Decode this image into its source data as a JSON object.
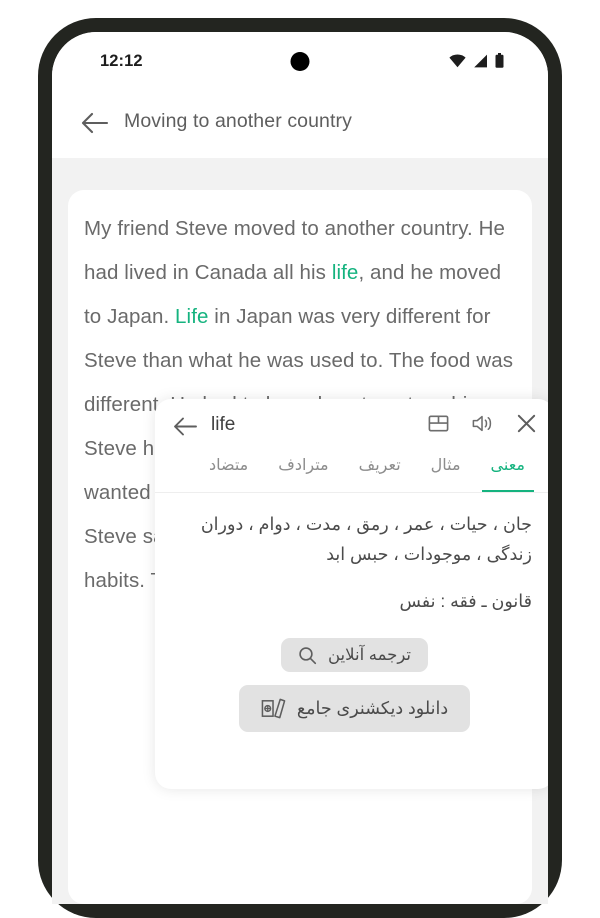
{
  "status_bar": {
    "time": "12:12",
    "icons": [
      "wifi-icon",
      "cellular-signal-icon",
      "battery-icon"
    ]
  },
  "app_bar": {
    "back_icon": "back-arrow-icon",
    "title": "Moving to another country"
  },
  "reader": {
    "paragraph_parts": [
      {
        "text": "My friend Steve moved to another country. He had lived in Canada all his ",
        "highlight": false
      },
      {
        "text": "life",
        "highlight": true
      },
      {
        "text": ", and he moved to Japan. ",
        "highlight": false
      },
      {
        "text": "Life",
        "highlight": true
      },
      {
        "text": " in Japan was very different for Steve than what he was used to. The food was different. He had to learn how to eat sushi. Steve had never eaten raw fish before. Steve wanted pizza, but it was expensive in Japan. Steve said that he had to adjust his eating habits. The people in",
        "highlight": false
      }
    ],
    "highlight_color": "#15b37f"
  },
  "dictionary_popup": {
    "back_icon": "back-arrow-icon",
    "word": "life",
    "actions": [
      {
        "name": "flashcard-icon",
        "label": "flashcard"
      },
      {
        "name": "speaker-icon",
        "label": "pronounce"
      },
      {
        "name": "close-icon",
        "label": "close"
      }
    ],
    "tabs": [
      {
        "label": "معنی",
        "active": true
      },
      {
        "label": "مثال",
        "active": false
      },
      {
        "label": "تعریف",
        "active": false
      },
      {
        "label": "مترادف",
        "active": false
      },
      {
        "label": "متضاد",
        "active": false
      }
    ],
    "meaning": "جان ، حیات ، عمر ، رمق ، مدت ، دوام ، دوران زندگی ، موجودات ، حبس ابد",
    "subline": "قانون ـ فقه : نفس",
    "buttons": [
      {
        "label": "ترجمه آنلاین",
        "icon": "search-icon"
      },
      {
        "label": "دانلود دیکشنری جامع",
        "icon": "books-icon"
      }
    ],
    "accent_color": "#15b37f"
  }
}
